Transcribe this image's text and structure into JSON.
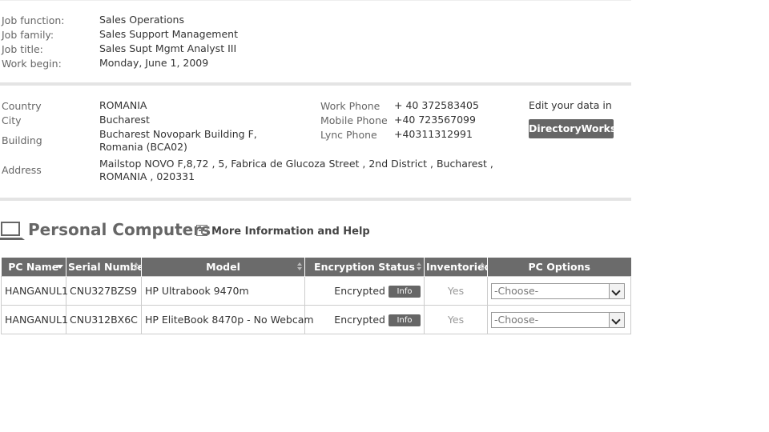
{
  "job": {
    "function_label": "Job function:",
    "function_value": "Sales Operations",
    "family_label": "Job family:",
    "family_value": "Sales Support Management",
    "title_label": "Job title:",
    "title_value": "Sales Supt Mgmt Analyst III",
    "begin_label": "Work begin:",
    "begin_value": "Monday, June 1, 2009"
  },
  "location": {
    "country_label": "Country",
    "country_value": "ROMANIA",
    "city_label": "City",
    "city_value": "Bucharest",
    "building_label": "Building",
    "building_value": "Bucharest Novopark Building F, Romania (BCA02)",
    "address_label": "Address",
    "address_value": "Mailstop NOVO F,8,72 , 5, Fabrica de Glucoza Street , 2nd District , Bucharest , ROMANIA , 020331"
  },
  "phones": {
    "work_label": "Work Phone",
    "work_value": "+ 40 372583405",
    "mobile_label": "Mobile Phone",
    "mobile_value": "+40 723567099",
    "lync_label": "Lync Phone",
    "lync_value": "+40311312991"
  },
  "edit": {
    "text": "Edit your data in",
    "button": "DirectoryWorks"
  },
  "pcs": {
    "section_title": "Personal Computers",
    "more_info": "More Information and Help",
    "columns": [
      "PC Name",
      "Serial Number",
      "Model",
      "Encryption Status",
      "Inventoried",
      "PC Options"
    ],
    "rows": [
      {
        "pc_name": "HANGANUL1",
        "serial": "CNU327BZS9",
        "model": "HP Ultrabook 9470m",
        "encryption": "Encrypted",
        "info": "Info",
        "inventoried": "Yes",
        "option": "-Choose-"
      },
      {
        "pc_name": "HANGANUL1",
        "serial": "CNU312BX6C",
        "model": "HP EliteBook 8470p - No Webcam",
        "encryption": "Encrypted",
        "info": "Info",
        "inventoried": "Yes",
        "option": "-Choose-"
      }
    ]
  },
  "colors": {
    "header_bg": "#6b6b6b",
    "button_bg": "#666666",
    "rule": "#e4e4e4"
  }
}
